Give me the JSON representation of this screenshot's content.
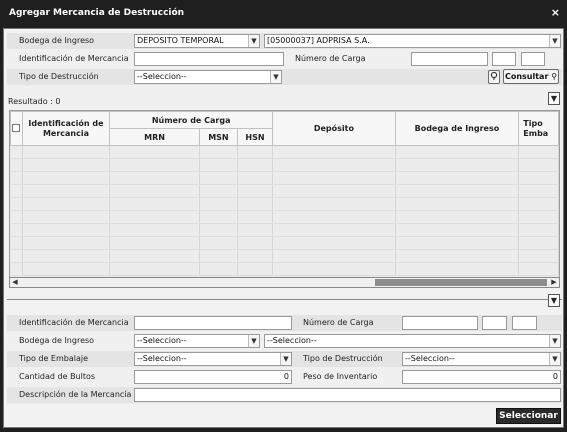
{
  "window": {
    "title": "Agregar Mercancia de Destrucción",
    "close": "×"
  },
  "search": {
    "bodega_label": "Bodega de Ingreso",
    "bodega_select": "DEPOSITO TEMPORAL",
    "bodega_detail": "[05000037] ADPRISA S.A.",
    "identificacion_label": "Identificación de Mercancia",
    "numero_carga_label": "Número de Carga",
    "tipo_destruccion_label": "Tipo de Destrucción",
    "tipo_destruccion_value": "--Seleccion--",
    "consultar_label": "Consultar"
  },
  "result": {
    "label": "Resultado : 0"
  },
  "grid": {
    "columns": {
      "identificacion": "Identificación de Mercancia",
      "numero_carga": "Número de Carga",
      "mrn": "MRN",
      "msn": "MSN",
      "hsn": "HSN",
      "deposito": "Depósito",
      "bodega": "Bodega de Ingreso",
      "tipo_embalaje": "Tipo Emba"
    },
    "rows": []
  },
  "detail": {
    "identificacion_label": "Identificación de Mercancia",
    "numero_carga_label": "Número de Carga",
    "bodega_label": "Bodega de Ingreso",
    "bodega_select": "--Seleccion--",
    "bodega_detail": "--Seleccion--",
    "tipo_embalaje_label": "Tipo de Embalaje",
    "tipo_embalaje_value": "--Seleccion--",
    "tipo_destruccion_label": "Tipo de Destrucción",
    "tipo_destruccion_value": "--Seleccion--",
    "cantidad_label": "Cantidad de Bultos",
    "cantidad_value": "0",
    "peso_label": "Peso de Inventario",
    "peso_value": "0",
    "descripcion_label": "Descripción de la Mercancía"
  },
  "footer": {
    "seleccionar_label": "Seleccionar"
  }
}
